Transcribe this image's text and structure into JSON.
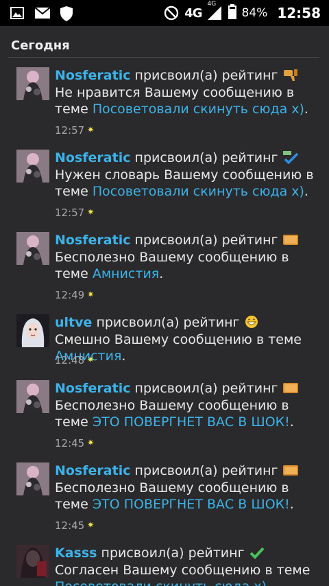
{
  "status_bar": {
    "icons": [
      "gallery-icon",
      "mail-icon",
      "shield-icon"
    ],
    "network": "4G",
    "network_small": "4G",
    "battery": "84%",
    "time": "12:58"
  },
  "section": {
    "title": "Сегодня"
  },
  "verb": "присвоил(а) рейтинг",
  "items": [
    {
      "user": "Nosferatic",
      "rating": "Не нравится",
      "rating_icon": "thumbs-down-icon",
      "tail": "Вашему сообщению в теме",
      "topic": "Посоветовали скинуть сюда х)",
      "dot": ".",
      "time": "12:57"
    },
    {
      "user": "Nosferatic",
      "rating": "Нужен словарь",
      "rating_icon": "abc-check-icon",
      "tail": "Вашему сообщению в теме",
      "topic": "Посоветовали скинуть сюда х)",
      "dot": ".",
      "time": "12:57"
    },
    {
      "user": "Nosferatic",
      "rating": "Бесполезно",
      "rating_icon": "box-icon",
      "tail": "Вашему сообщению в теме",
      "topic": "Амнистия",
      "dot": ".",
      "time": "12:49"
    },
    {
      "user": "ultve",
      "rating": "Смешно",
      "rating_icon": "laughing-face-icon",
      "tail": "Вашему сообщению в теме",
      "topic": "Амнистия",
      "dot": ".",
      "time": "12:48"
    },
    {
      "user": "Nosferatic",
      "rating": "Бесполезно",
      "rating_icon": "box-icon",
      "tail": "Вашему сообщению в теме",
      "topic": "ЭТО ПОВЕРГНЕТ ВАС В ШОК!",
      "dot": ".",
      "time": "12:45"
    },
    {
      "user": "Nosferatic",
      "rating": "Бесполезно",
      "rating_icon": "box-icon",
      "tail": "Вашему сообщению в теме",
      "topic": "ЭТО ПОВЕРГНЕТ ВАС В ШОК!",
      "dot": ".",
      "time": "12:45"
    },
    {
      "user": "Kasss",
      "rating": "Согласен",
      "rating_icon": "check-icon",
      "tail": "Вашему сообщению в теме",
      "topic": "Посоветовали скинуть сюда х)",
      "dot": ".",
      "time": ""
    }
  ],
  "colors": {
    "link": "#3cb3ea",
    "background": "#2a2a2c",
    "statusbar": "#000000"
  }
}
